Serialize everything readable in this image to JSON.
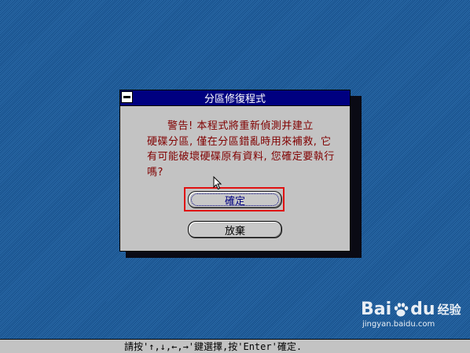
{
  "dialog": {
    "title": "分區修復程式",
    "message_line1": "警告! 本程式將重新偵測并建立",
    "message_rest": "硬碟分區, 僅在分區錯亂時用來補救, 它有可能破壞硬碟原有資料, 您確定要執行嗎?",
    "confirm_label": "確定",
    "cancel_label": "放棄"
  },
  "statusbar": {
    "text": "請按'↑,↓,←,→'鍵選擇,按'Enter'確定."
  },
  "watermark": {
    "brand_bai": "Bai",
    "brand_du": "du",
    "brand_jingyan": "经验",
    "url": "jingyan.baidu.com"
  },
  "colors": {
    "desktop": "#1e5a96",
    "titlebar": "#000080",
    "dialog_bg": "#c3c3c3",
    "message_text": "#800000",
    "highlight": "#e01010"
  },
  "icons": {
    "system_menu": "system-menu-icon",
    "cursor": "mouse-cursor-icon",
    "watermark_paw": "baidu-paw-icon"
  }
}
